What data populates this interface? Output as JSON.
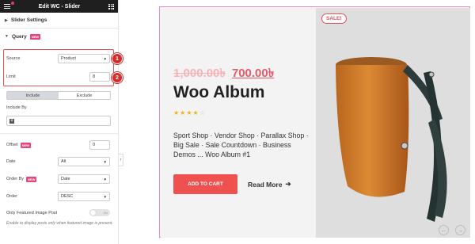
{
  "panel": {
    "title": "Edit WC - Slider",
    "slider_settings_label": "Slider Settings",
    "query_label": "Query",
    "new_badge": "NEW",
    "source": {
      "label": "Source",
      "value": "Product"
    },
    "limit": {
      "label": "Limit",
      "value": "8"
    },
    "tabs": [
      "Include",
      "Exclude"
    ],
    "include_by_label": "Include By",
    "offset": {
      "label": "Offset",
      "value": "0"
    },
    "date": {
      "label": "Date",
      "value": "All"
    },
    "order_by": {
      "label": "Order By",
      "value": "Date"
    },
    "order": {
      "label": "Order",
      "value": "DESC"
    },
    "featured": {
      "label": "Only Featured Image Post",
      "toggle_text": "No"
    },
    "note": "Enable to display posts only when featured image is present.",
    "annotations": [
      "1",
      "2"
    ]
  },
  "slide": {
    "sale_badge": "SALE!",
    "old_price": "1,000.00৳",
    "new_price": "700.00৳",
    "product_name": "Woo Album",
    "rating_stars": 4,
    "rating_max": 5,
    "description": "Sport Shop · Vendor Shop · Parallax Shop · Big Sale · Sale Countdown · Business Demos ... Woo Album #1",
    "add_to_cart": "ADD TO CART",
    "read_more": "Read More"
  },
  "colors": {
    "accent": "#ef5150",
    "annotation": "#d62b2b",
    "old_price": "#f6b3b7",
    "slide_border": "#e38ad5"
  }
}
